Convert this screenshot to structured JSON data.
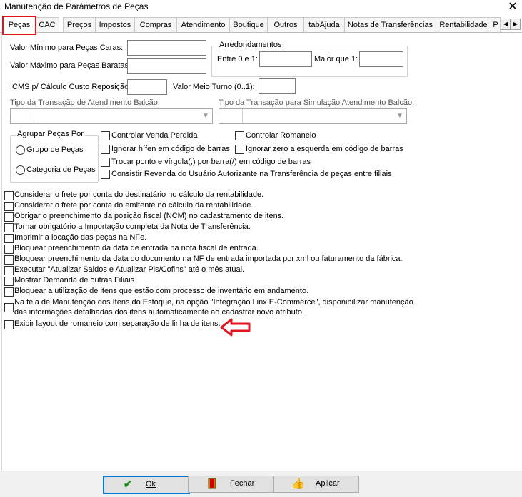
{
  "window": {
    "title": "Manutenção de Parâmetros de Peças",
    "close_glyph": "✕"
  },
  "tabs": [
    {
      "label": "Peças",
      "active": true
    },
    {
      "label": "CAC"
    },
    {
      "label": "Preços"
    },
    {
      "label": "Impostos"
    },
    {
      "label": "Compras"
    },
    {
      "label": "Atendimento"
    },
    {
      "label": "Boutique"
    },
    {
      "label": "Outros"
    },
    {
      "label": "tabAjuda"
    },
    {
      "label": "Notas de Transferências"
    },
    {
      "label": "Rentabilidade"
    },
    {
      "label": "P"
    }
  ],
  "tab_scroll": {
    "left": "◀",
    "right": "▶"
  },
  "fields": {
    "valor_min_label": "Valor Mínimo para Peças Caras:",
    "valor_max_label": "Valor Máximo para Peças Baratas:",
    "icms_label": "ICMS p/ Cálculo Custo Reposição:",
    "meio_turno_label": "Valor Meio Turno (0..1):"
  },
  "arredondamentos": {
    "legend": "Arredondamentos",
    "entre_label": "Entre 0 e 1:",
    "maior_label": "Maior que 1:"
  },
  "combos": {
    "balcao_label": "Tipo da Transação de Atendimento Balcão:",
    "simulacao_label": "Tipo da Transação para Simulação Atendimento Balcão:",
    "arrow": "▼"
  },
  "agrupar": {
    "legend": "Agrupar Peças Por",
    "options": [
      "Grupo de Peças",
      "Categoria de Peças"
    ]
  },
  "checks_top": [
    "Controlar Venda Perdida",
    "Controlar Romaneio",
    "Ignorar hífen em código de barras",
    "Ignorar zero a esquerda em código de barras",
    "Trocar ponto e vírgula(;) por barra(/) em código de barras",
    "Consistir Revenda do Usuário Autorizante na Transferência de peças entre filiais"
  ],
  "checks_list": [
    "Considerar o frete por conta do destinatário no cálculo da rentabilidade.",
    "Considerar o frete por conta do emitente no cálculo da rentabilidade.",
    "Obrigar o preenchimento da posição fiscal (NCM) no cadastramento de itens.",
    "Tornar obrigatório a Importação completa da Nota de Transferência.",
    "Imprimir a locação das peças na NFe.",
    "Bloquear preenchimento da data de entrada na nota fiscal de entrada.",
    "Bloquear preenchimento da data do documento na NF de entrada importada por xml ou faturamento da fábrica.",
    "Executar \"Atualizar Saldos e Atualizar Pis/Cofins\" até o mês atual.",
    "Mostrar Demanda de outras Filiais",
    "Bloquear a utilização de itens que estão com processo de inventário em andamento."
  ],
  "check_multiline": {
    "line1": "Na tela de Manutenção dos Itens do Estoque, na opção \"Integração Linx E-Commerce\", disponibilizar manutenção",
    "line2": "das informações detalhadas dos itens automaticamente ao cadastrar novo atributo."
  },
  "check_last": "Exibir layout de romaneio com separação de linha de itens.",
  "annotation_color": "#e0141e",
  "buttons": [
    {
      "label": "Ok",
      "icon": "check-icon"
    },
    {
      "label": "Fechar",
      "icon": "door-exit-icon"
    },
    {
      "label": "Aplicar",
      "icon": "thumbs-up-icon"
    }
  ]
}
